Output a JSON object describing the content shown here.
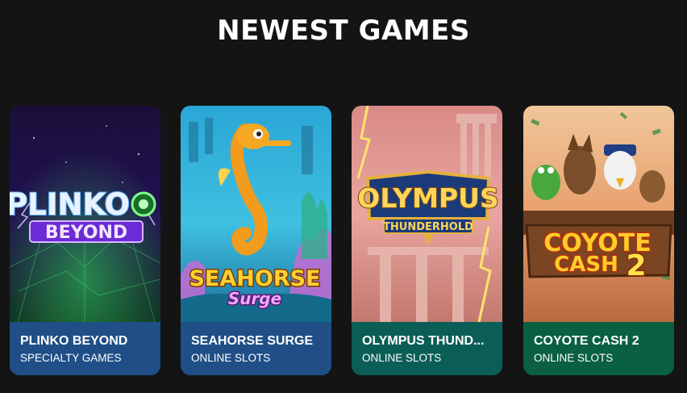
{
  "section": {
    "title": "NEWEST GAMES"
  },
  "games": [
    {
      "name": "PLINKO BEYOND",
      "category": "SPECIALTY GAMES",
      "art_title": "PLINKO",
      "art_subtitle": "BEYOND",
      "info_color": "#1f4f86"
    },
    {
      "name": "SEAHORSE SURGE",
      "category": "ONLINE SLOTS",
      "art_title": "SEAHORSE",
      "art_subtitle": "Surge",
      "info_color": "#1f4f86"
    },
    {
      "name": "OLYMPUS THUND...",
      "category": "ONLINE SLOTS",
      "art_title": "OLYMPUS",
      "art_subtitle": "THUNDERHOLD",
      "info_color": "#0b5e55"
    },
    {
      "name": "COYOTE CASH 2",
      "category": "ONLINE SLOTS",
      "art_title": "COYOTE",
      "art_subtitle": "CASH",
      "art_number": "2",
      "info_color": "#0a6040"
    }
  ]
}
